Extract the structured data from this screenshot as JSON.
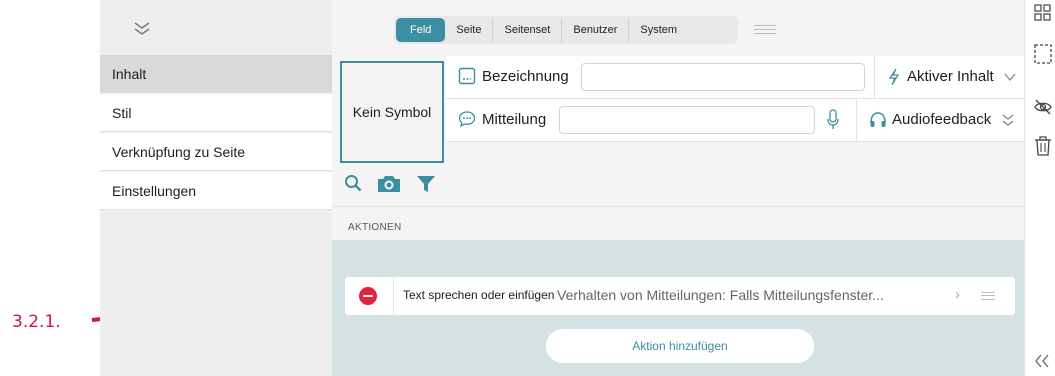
{
  "annotation": {
    "label": "3.2.1.",
    "color": "#e0103c"
  },
  "sidebar": {
    "items": [
      {
        "label": "Inhalt",
        "selected": true
      },
      {
        "label": "Stil",
        "selected": false
      },
      {
        "label": "Verknüpfung zu Seite",
        "selected": false
      },
      {
        "label": "Einstellungen",
        "selected": false
      }
    ]
  },
  "tabs": {
    "items": [
      "Feld",
      "Seite",
      "Seitenset",
      "Benutzer",
      "System"
    ],
    "active": "Feld",
    "accent": "#3c8ea3"
  },
  "field": {
    "symbol_label": "Kein Symbol",
    "name_label": "Bezeichnung",
    "name_value": "",
    "active_content_label": "Aktiver Inhalt",
    "message_label": "Mitteilung",
    "message_value": "",
    "audio_feedback_label": "Audiofeedback"
  },
  "actions": {
    "section_title": "AKTIONEN",
    "items": [
      {
        "name": "Text sprechen oder einfügen",
        "description": "Verhalten von Mitteilungen: Falls Mitteilungsfenster..."
      }
    ],
    "add_label": "Aktion hinzufügen",
    "remove_color": "#e8203c"
  },
  "icons": {
    "collapse": "chevron-double-down-icon",
    "right_bar": [
      "grid-icon",
      "dashed-select-icon",
      "hidden-eye-icon",
      "trash-icon",
      "double-chevron-left-icon"
    ]
  }
}
